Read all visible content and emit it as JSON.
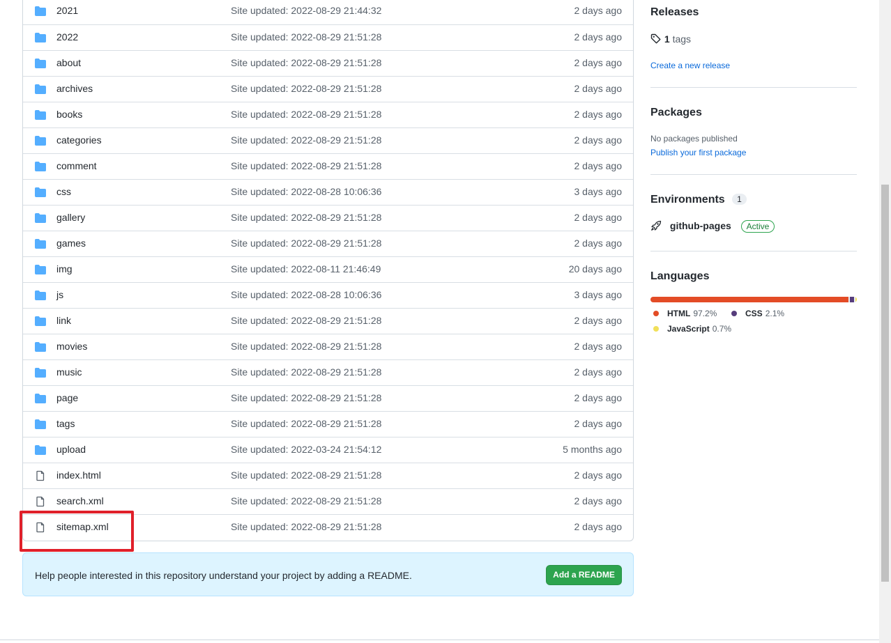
{
  "files": [
    {
      "type": "dir",
      "name": "2021",
      "message": "Site updated: 2022-08-29 21:44:32",
      "age": "2 days ago"
    },
    {
      "type": "dir",
      "name": "2022",
      "message": "Site updated: 2022-08-29 21:51:28",
      "age": "2 days ago"
    },
    {
      "type": "dir",
      "name": "about",
      "message": "Site updated: 2022-08-29 21:51:28",
      "age": "2 days ago"
    },
    {
      "type": "dir",
      "name": "archives",
      "message": "Site updated: 2022-08-29 21:51:28",
      "age": "2 days ago"
    },
    {
      "type": "dir",
      "name": "books",
      "message": "Site updated: 2022-08-29 21:51:28",
      "age": "2 days ago"
    },
    {
      "type": "dir",
      "name": "categories",
      "message": "Site updated: 2022-08-29 21:51:28",
      "age": "2 days ago"
    },
    {
      "type": "dir",
      "name": "comment",
      "message": "Site updated: 2022-08-29 21:51:28",
      "age": "2 days ago"
    },
    {
      "type": "dir",
      "name": "css",
      "message": "Site updated: 2022-08-28 10:06:36",
      "age": "3 days ago"
    },
    {
      "type": "dir",
      "name": "gallery",
      "message": "Site updated: 2022-08-29 21:51:28",
      "age": "2 days ago"
    },
    {
      "type": "dir",
      "name": "games",
      "message": "Site updated: 2022-08-29 21:51:28",
      "age": "2 days ago"
    },
    {
      "type": "dir",
      "name": "img",
      "message": "Site updated: 2022-08-11 21:46:49",
      "age": "20 days ago"
    },
    {
      "type": "dir",
      "name": "js",
      "message": "Site updated: 2022-08-28 10:06:36",
      "age": "3 days ago"
    },
    {
      "type": "dir",
      "name": "link",
      "message": "Site updated: 2022-08-29 21:51:28",
      "age": "2 days ago"
    },
    {
      "type": "dir",
      "name": "movies",
      "message": "Site updated: 2022-08-29 21:51:28",
      "age": "2 days ago"
    },
    {
      "type": "dir",
      "name": "music",
      "message": "Site updated: 2022-08-29 21:51:28",
      "age": "2 days ago"
    },
    {
      "type": "dir",
      "name": "page",
      "message": "Site updated: 2022-08-29 21:51:28",
      "age": "2 days ago"
    },
    {
      "type": "dir",
      "name": "tags",
      "message": "Site updated: 2022-08-29 21:51:28",
      "age": "2 days ago"
    },
    {
      "type": "dir",
      "name": "upload",
      "message": "Site updated: 2022-03-24 21:54:12",
      "age": "5 months ago"
    },
    {
      "type": "file",
      "name": "index.html",
      "message": "Site updated: 2022-08-29 21:51:28",
      "age": "2 days ago"
    },
    {
      "type": "file",
      "name": "search.xml",
      "message": "Site updated: 2022-08-29 21:51:28",
      "age": "2 days ago"
    },
    {
      "type": "file",
      "name": "sitemap.xml",
      "message": "Site updated: 2022-08-29 21:51:28",
      "age": "2 days ago"
    }
  ],
  "readme": {
    "text": "Help people interested in this repository understand your project by adding a README.",
    "button": "Add a README"
  },
  "sidebar": {
    "releases": {
      "title": "Releases",
      "tag_count": "1",
      "tag_word": "tags",
      "create_link": "Create a new release"
    },
    "packages": {
      "title": "Packages",
      "none_text": "No packages published",
      "publish_link": "Publish your first package"
    },
    "environments": {
      "title": "Environments",
      "count": "1",
      "env_name": "github-pages",
      "env_status": "Active"
    },
    "languages": {
      "title": "Languages",
      "items": [
        {
          "name": "HTML",
          "percent": "97.2%",
          "value": 97.2,
          "color": "#e34c26"
        },
        {
          "name": "CSS",
          "percent": "2.1%",
          "value": 2.1,
          "color": "#563d7c"
        },
        {
          "name": "JavaScript",
          "percent": "0.7%",
          "value": 0.7,
          "color": "#f1e05a"
        }
      ]
    }
  },
  "colors": {
    "folder": "#54aeff",
    "file_icon": "#57606a",
    "highlight": "#e0202a"
  }
}
